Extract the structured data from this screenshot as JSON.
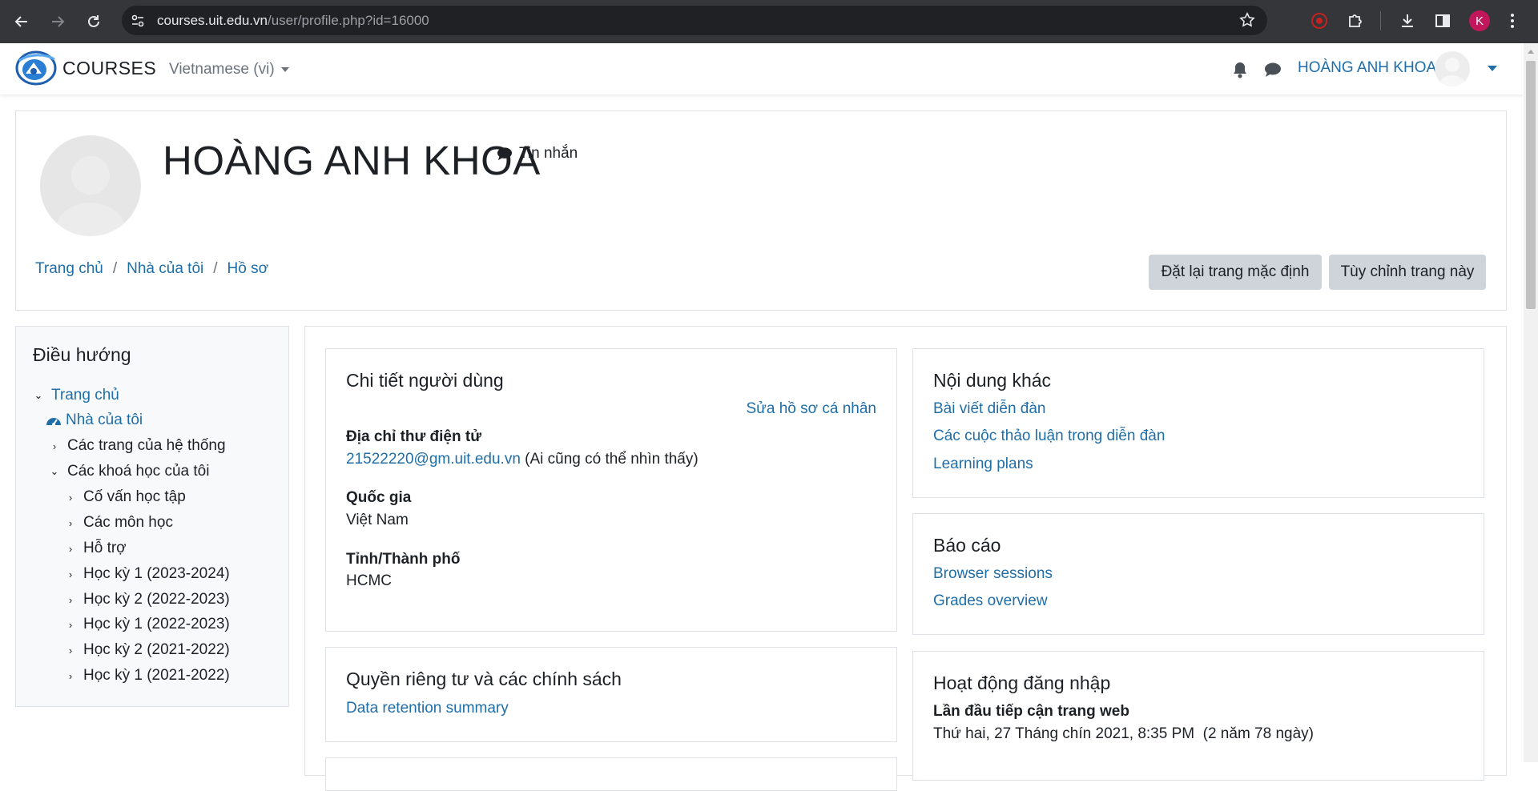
{
  "browser": {
    "url_domain": "courses.uit.edu.vn",
    "url_path": "/user/profile.php?id=16000",
    "profile_initial": "K"
  },
  "navbar": {
    "brand": "COURSES",
    "language": "Vietnamese (vi)",
    "user_name": "HOÀNG ANH KHOA"
  },
  "header": {
    "full_name": "HOÀNG ANH KHOA",
    "message_label": "Tin nhắn",
    "breadcrumb": [
      "Trang chủ",
      "Nhà của tôi",
      "Hồ sơ"
    ],
    "reset_button": "Đặt lại trang mặc định",
    "customize_button": "Tùy chỉnh trang này"
  },
  "nav": {
    "title": "Điều hướng",
    "home": "Trang chủ",
    "dashboard": "Nhà của tôi",
    "site_pages": "Các trang của hệ thống",
    "my_courses": "Các khoá học của tôi",
    "courses": [
      "Cố vấn học tập",
      "Các môn học",
      "Hỗ trợ",
      "Học kỳ 1 (2023-2024)",
      "Học kỳ 2 (2022-2023)",
      "Học kỳ 1 (2022-2023)",
      "Học kỳ 2 (2021-2022)",
      "Học kỳ 1 (2021-2022)"
    ]
  },
  "user_details": {
    "title": "Chi tiết người dùng",
    "edit_link": "Sửa hồ sơ cá nhân",
    "email_label": "Địa chỉ thư điện tử",
    "email": "21522220@gm.uit.edu.vn",
    "email_visibility": "(Ai cũng có thể nhìn thấy)",
    "country_label": "Quốc gia",
    "country": "Việt Nam",
    "city_label": "Tỉnh/Thành phố",
    "city": "HCMC"
  },
  "privacy": {
    "title": "Quyền riêng tư và các chính sách",
    "link": "Data retention summary"
  },
  "misc": {
    "title": "Nội dung khác",
    "links": [
      "Bài viết diễn đàn",
      "Các cuộc thảo luận trong diễn đàn",
      "Learning plans"
    ]
  },
  "reports": {
    "title": "Báo cáo",
    "links": [
      "Browser sessions",
      "Grades overview"
    ]
  },
  "login_activity": {
    "title": "Hoạt động đăng nhập",
    "first_access_label": "Lần đầu tiếp cận trang web",
    "first_access_value": "Thứ hai, 27 Tháng chín 2021, 8:35 PM  (2 năm 78 ngày)"
  },
  "colors": {
    "link": "#1f6ea8",
    "chrome_bg": "#35363a",
    "button_bg": "#ced4da"
  }
}
